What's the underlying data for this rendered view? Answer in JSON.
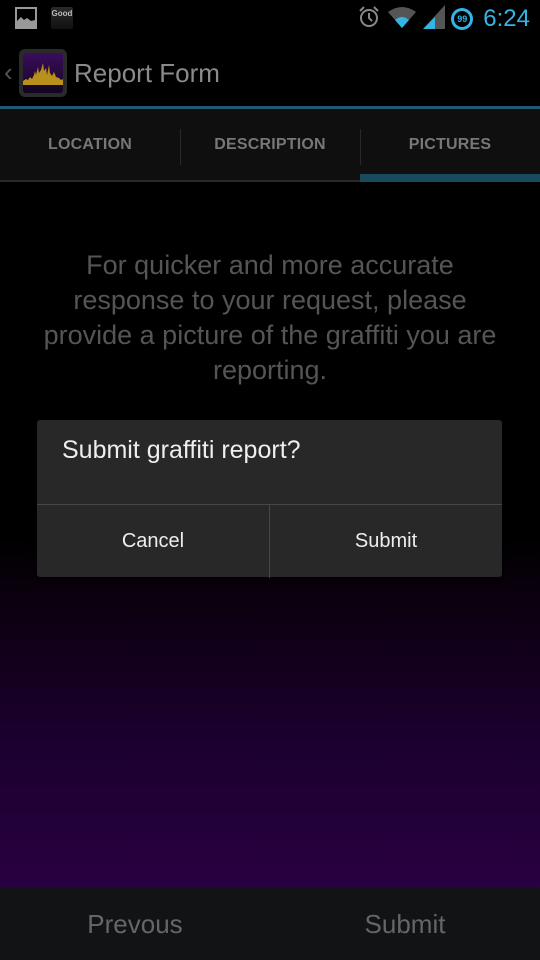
{
  "status_bar": {
    "notifications": [
      {
        "icon": "gallery-icon"
      },
      {
        "icon": "good-app-icon",
        "label": "Good"
      }
    ],
    "icons": [
      "alarm-icon",
      "wifi-icon",
      "cell-signal-icon"
    ],
    "battery_level": "99",
    "time": "6:24"
  },
  "action_bar": {
    "title": "Report Form"
  },
  "tabs": [
    {
      "label": "LOCATION",
      "active": false
    },
    {
      "label": "DESCRIPTION",
      "active": false
    },
    {
      "label": "PICTURES",
      "active": true
    }
  ],
  "content": {
    "hint": "For quicker and more accurate response to your request, please provide a picture of the graffiti you are reporting."
  },
  "dialog": {
    "title": "Submit graffiti report?",
    "cancel_label": "Cancel",
    "submit_label": "Submit"
  },
  "bottom_bar": {
    "previous_label": "Prevous",
    "submit_label": "Submit"
  },
  "colors": {
    "accent": "#33b5e5",
    "tab_indicator": "#1a4a5e",
    "background_gradient_end": "#290040"
  }
}
